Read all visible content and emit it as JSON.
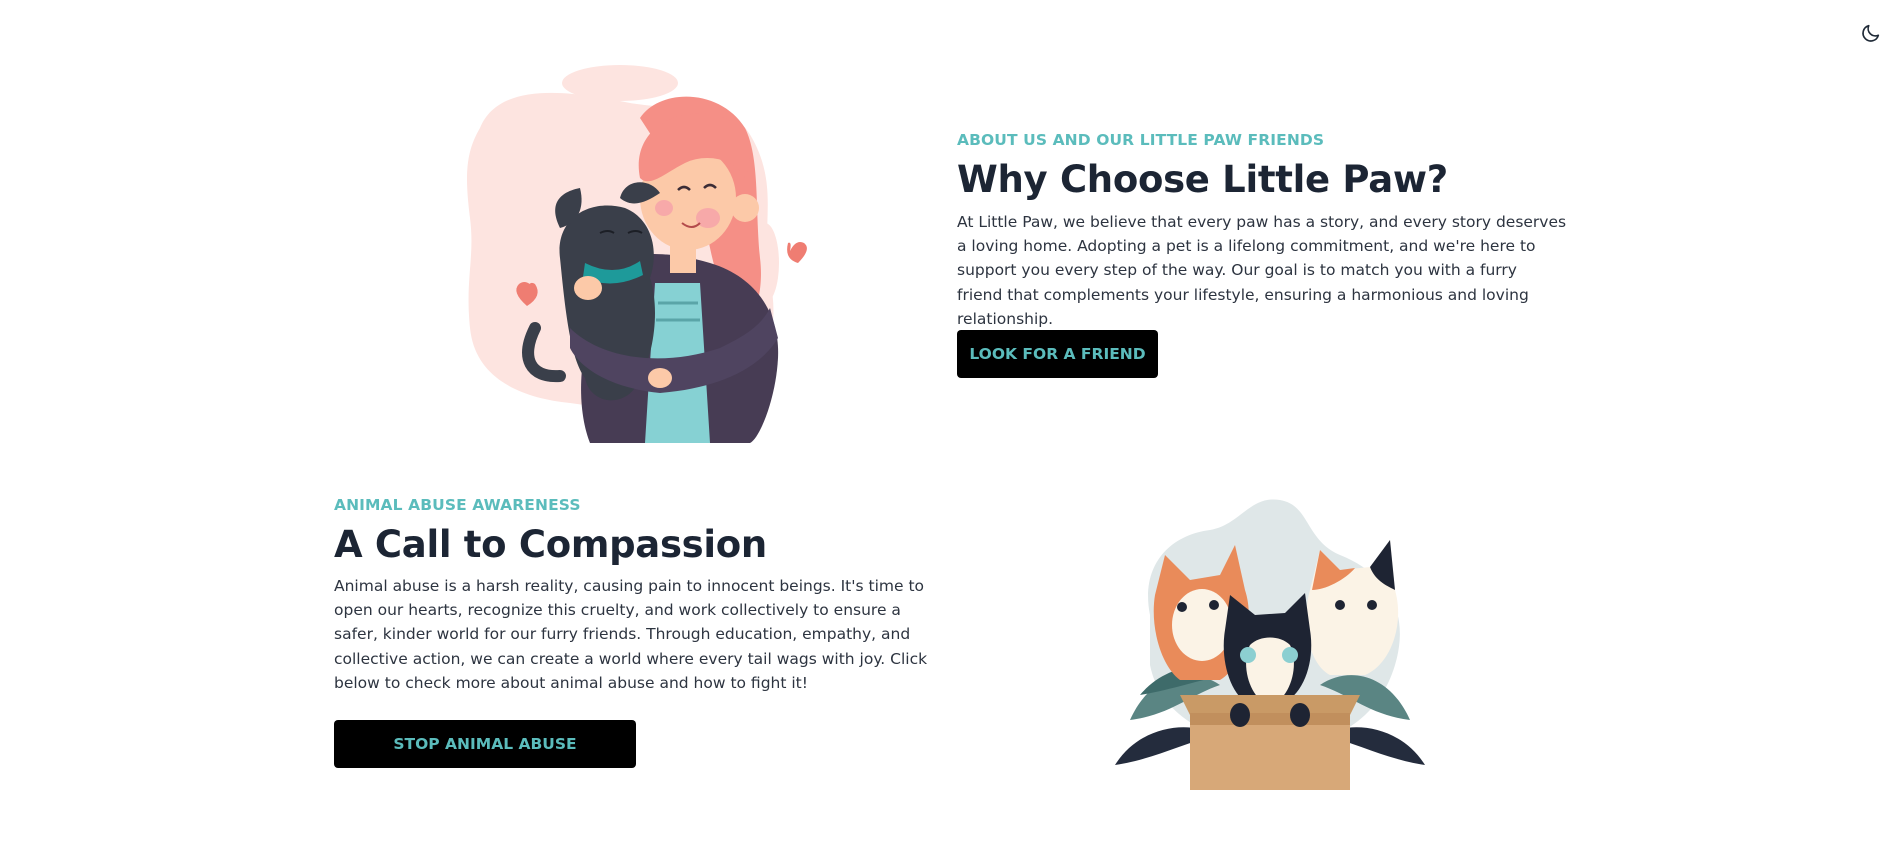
{
  "header": {
    "theme_toggle_icon": "moon-icon"
  },
  "about": {
    "eyebrow": "ABOUT US AND OUR LITTLE PAW FRIENDS",
    "title": "Why Choose Little Paw?",
    "text": "At Little Paw, we believe that every paw has a story, and every story deserves a loving home. Adopting a pet is a lifelong commitment, and we're here to support you every step of the way. Our goal is to match you with a furry friend that complements your lifestyle, ensuring a harmonious and loving relationship.",
    "button_label": "LOOK FOR A FRIEND",
    "illustration": "woman-hugging-dog-illustration"
  },
  "awareness": {
    "eyebrow": "ANIMAL ABUSE AWARENESS",
    "title": "A Call to Compassion",
    "text": "Animal abuse is a harsh reality, causing pain to innocent beings. It's time to open our hearts, recognize this cruelty, and work collectively to ensure a safer, kinder world for our furry friends. Through education, empathy, and collective action, we can create a world where every tail wags with joy. Click below to check more about animal abuse and how to fight it!",
    "button_label": "STOP ANIMAL ABUSE",
    "illustration": "cats-in-box-illustration"
  },
  "colors": {
    "accent": "#5bbcbc",
    "heading": "#1c2534",
    "button_bg": "#000000"
  }
}
